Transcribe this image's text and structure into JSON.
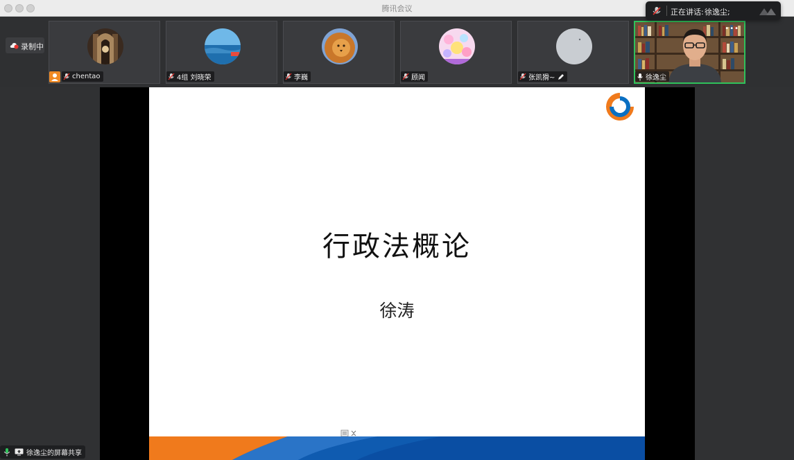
{
  "window": {
    "title": "腾讯会议"
  },
  "speaker_toast": {
    "label": "正在讲话:",
    "speaker": "徐逸尘;"
  },
  "recording": {
    "label": "录制中"
  },
  "participants": [
    {
      "name": "chentao",
      "host": true
    },
    {
      "name": "4组 刘晓荣"
    },
    {
      "name": "李巍"
    },
    {
      "name": "顾闻"
    },
    {
      "name": "张凯猾~"
    },
    {
      "name": "徐逸尘",
      "active": true
    }
  ],
  "slide": {
    "title": "行政法概论",
    "author": "徐涛"
  },
  "share_indicator": {
    "label": "徐逸尘的屏幕共享"
  },
  "colors": {
    "active_border": "#2fc25b",
    "host_badge": "#f08a24",
    "recording_dot": "#e5322d",
    "footer_orange": "#f07a1c",
    "footer_blue": "#0a4ea3"
  }
}
